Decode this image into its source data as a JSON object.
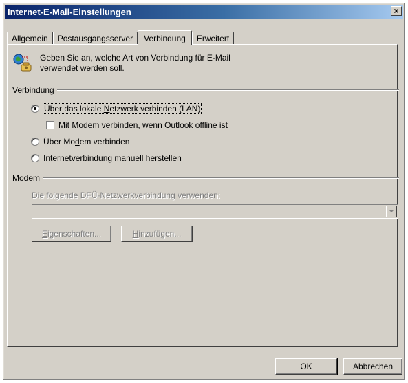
{
  "window": {
    "title": "Internet-E-Mail-Einstellungen",
    "close_glyph": "×"
  },
  "tabs": [
    {
      "label": "Allgemein",
      "active": false
    },
    {
      "label": "Postausgangsserver",
      "active": false
    },
    {
      "label": "Verbindung",
      "active": true
    },
    {
      "label": "Erweitert",
      "active": false
    }
  ],
  "info": {
    "line1": "Geben Sie an, welche Art von Verbindung für E-Mail",
    "line2": "verwendet werden soll.",
    "icon": "connection-icon"
  },
  "connection": {
    "group_label": "Verbindung",
    "lan": {
      "before": "Über das lokale ",
      "accel": "N",
      "after": "etzwerk verbinden (LAN)",
      "selected": true
    },
    "modem_offline": {
      "before": "",
      "accel": "M",
      "after": "it Modem verbinden, wenn Outlook offline ist",
      "checked": false
    },
    "modem": {
      "before": "Über Mo",
      "accel": "d",
      "after": "em verbinden",
      "selected": false
    },
    "manual": {
      "before": "",
      "accel": "I",
      "after": "nternetverbindung manuell herstellen",
      "selected": false
    }
  },
  "modem": {
    "group_label": "Modem",
    "use_label": "Die folgende DFÜ-Netzwerkverbindung verwenden:",
    "combo_value": "",
    "properties": {
      "before": "",
      "accel": "E",
      "after": "igenschaften..."
    },
    "add": {
      "before": "",
      "accel": "H",
      "after": "inzufügen..."
    }
  },
  "footer": {
    "ok": "OK",
    "cancel": "Abbrechen"
  },
  "colors": {
    "face": "#d4d0c8",
    "title_start": "#0a246a",
    "title_end": "#a6caf0"
  }
}
